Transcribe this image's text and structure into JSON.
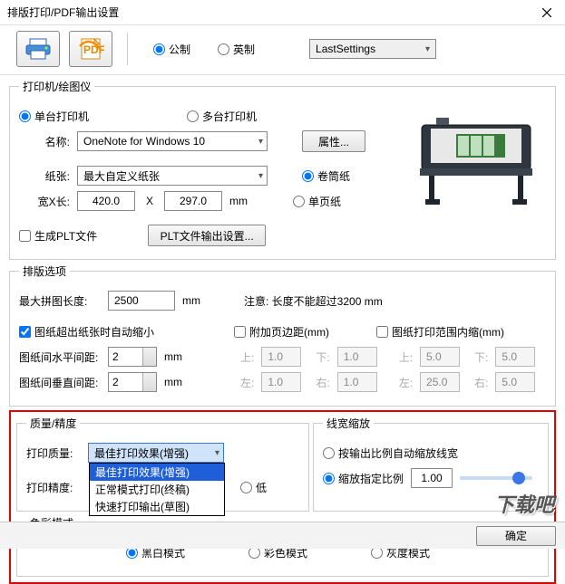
{
  "window": {
    "title": "排版打印/PDF输出设置"
  },
  "toolbar": {
    "units_metric": "公制",
    "units_imperial": "英制",
    "preset": "LastSettings"
  },
  "printer_group": {
    "legend": "打印机/绘图仪",
    "single_printer": "单台打印机",
    "multi_printer": "多台打印机",
    "name_label": "名称:",
    "name_value": "OneNote for Windows 10",
    "props_btn": "属性...",
    "paper_label": "纸张:",
    "paper_value": "最大自定义纸张",
    "roll_paper": "卷筒纸",
    "wxh_label": "宽X长:",
    "width": "420.0",
    "x": "X",
    "height": "297.0",
    "mm": "mm",
    "sheet_paper": "单页纸",
    "gen_plt": "生成PLT文件",
    "plt_btn": "PLT文件输出设置..."
  },
  "layout_group": {
    "legend": "排版选项",
    "max_collage_label": "最大拼图长度:",
    "max_collage_value": "2500",
    "mm": "mm",
    "note": "注意: 长度不能超过3200 mm",
    "auto_shrink": "图纸超出纸张时自动缩小",
    "add_margin": "附加页边距(mm)",
    "inner_shrink": "图纸打印范围内缩(mm)",
    "hspace_label": "图纸间水平间距:",
    "hspace_value": "2",
    "vspace_label": "图纸间垂直间距:",
    "vspace_value": "2",
    "top": "上:",
    "bottom": "下:",
    "left": "左:",
    "right": "右:",
    "top_v": "1.0",
    "bottom_v": "1.0",
    "left_v": "1.0",
    "right_v": "1.0",
    "top2_v": "5.0",
    "bottom2_v": "5.0",
    "left2_v": "25.0",
    "right2_v": "5.0"
  },
  "quality_group": {
    "legend": "质量/精度",
    "qlabel": "打印质量:",
    "qvalue": "最佳打印效果(增强)",
    "qoptions": [
      "最佳打印效果(增强)",
      "正常模式打印(终稿)",
      "快速打印输出(草图)"
    ],
    "plabel": "打印精度:",
    "low": "低",
    "colormode_label": "色彩模式",
    "mono": "黑白模式",
    "color": "彩色模式",
    "gray": "灰度模式"
  },
  "linewidth_group": {
    "legend": "线宽缩放",
    "auto": "按输出比例自动缩放线宽",
    "fixed": "缩放指定比例",
    "ratio": "1.00"
  },
  "footer": {
    "ok": "确定"
  },
  "watermark": "下载吧"
}
